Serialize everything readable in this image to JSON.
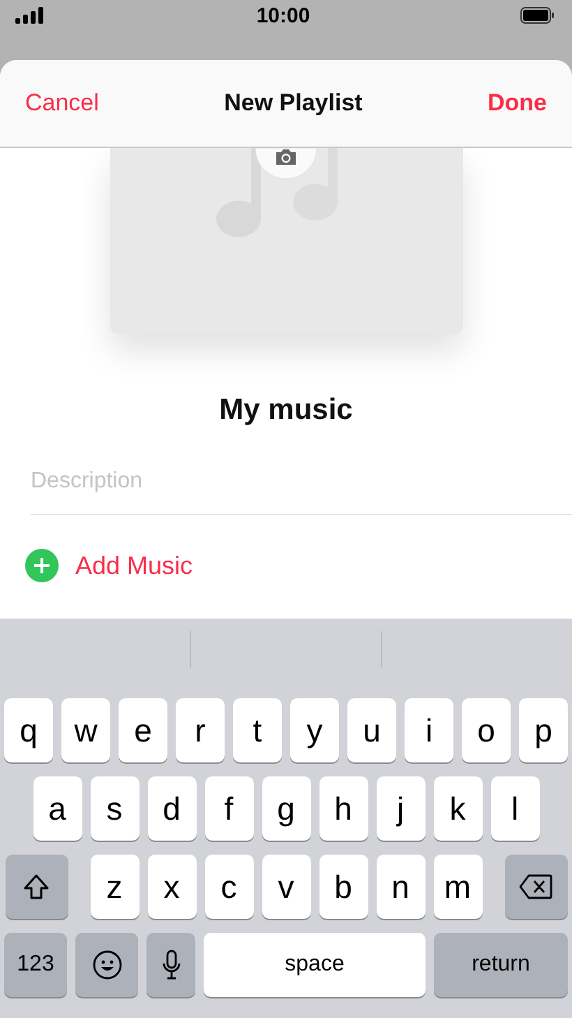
{
  "status_bar": {
    "time": "10:00"
  },
  "sheet": {
    "cancel": "Cancel",
    "title": "New Playlist",
    "done": "Done"
  },
  "playlist": {
    "name": "My music",
    "description": {
      "placeholder": "Description"
    },
    "add_music": "Add Music"
  },
  "keyboard": {
    "rows": [
      {
        "keys": [
          {
            "kind": "letter",
            "label": "q"
          },
          {
            "kind": "letter",
            "label": "w"
          },
          {
            "kind": "letter",
            "label": "e"
          },
          {
            "kind": "letter",
            "label": "r"
          },
          {
            "kind": "letter",
            "label": "t"
          },
          {
            "kind": "letter",
            "label": "y"
          },
          {
            "kind": "letter",
            "label": "u"
          },
          {
            "kind": "letter",
            "label": "i"
          },
          {
            "kind": "letter",
            "label": "o"
          },
          {
            "kind": "letter",
            "label": "p"
          }
        ]
      },
      {
        "keys": [
          {
            "kind": "letter",
            "label": "a"
          },
          {
            "kind": "letter",
            "label": "s"
          },
          {
            "kind": "letter",
            "label": "d"
          },
          {
            "kind": "letter",
            "label": "f"
          },
          {
            "kind": "letter",
            "label": "g"
          },
          {
            "kind": "letter",
            "label": "h"
          },
          {
            "kind": "letter",
            "label": "j"
          },
          {
            "kind": "letter",
            "label": "k"
          },
          {
            "kind": "letter",
            "label": "l"
          }
        ]
      },
      {
        "keys": [
          {
            "kind": "shift"
          },
          {
            "kind": "letter",
            "label": "z"
          },
          {
            "kind": "letter",
            "label": "x"
          },
          {
            "kind": "letter",
            "label": "c"
          },
          {
            "kind": "letter",
            "label": "v"
          },
          {
            "kind": "letter",
            "label": "b"
          },
          {
            "kind": "letter",
            "label": "n"
          },
          {
            "kind": "letter",
            "label": "m"
          },
          {
            "kind": "delete"
          }
        ]
      },
      {
        "keys": [
          {
            "kind": "mode",
            "label": "123"
          },
          {
            "kind": "emoji"
          },
          {
            "kind": "mic"
          },
          {
            "kind": "space",
            "label": "space"
          },
          {
            "kind": "return",
            "label": "return"
          }
        ]
      }
    ]
  }
}
